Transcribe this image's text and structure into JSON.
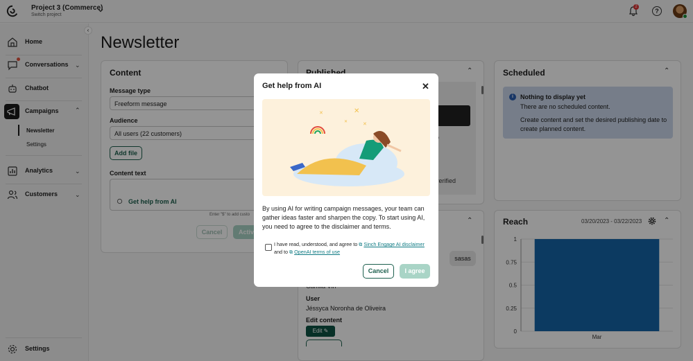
{
  "header": {
    "project_name": "Project 3 (Commerce)",
    "project_sub": "Switch project",
    "notif_count": "2",
    "help_glyph": "?"
  },
  "sidebar": {
    "items": [
      {
        "label": "Home",
        "icon": "home-icon"
      },
      {
        "label": "Conversations",
        "icon": "chat-icon"
      },
      {
        "label": "Chatbot",
        "icon": "bot-icon"
      },
      {
        "label": "Campaigns",
        "icon": "megaphone-icon"
      },
      {
        "label": "Analytics",
        "icon": "chart-icon"
      },
      {
        "label": "Customers",
        "icon": "users-icon"
      }
    ],
    "sub_items": [
      "Newsletter",
      "Settings"
    ],
    "settings_label": "Settings"
  },
  "page": {
    "title": "Newsletter"
  },
  "content_card": {
    "title": "Content",
    "message_type_label": "Message type",
    "message_type_value": "Freeform message",
    "audience_label": "Audience",
    "audience_value": "All users (22 customers)",
    "add_file": "Add file",
    "content_text_label": "Content text",
    "ai_button": "Get help from AI",
    "hint": "Enter \"$\" to add custo",
    "cancel": "Cancel",
    "activate": "Activ"
  },
  "published_card": {
    "title": "Published",
    "preview_frag_1": "o",
    "preview_frag_2": "verified",
    "msg_bubble": "sasas",
    "name_frag": "Camila Vin",
    "user_label": "User",
    "user_value": "Jéssyca Noronha de Oliveira",
    "edit_label": "Edit content",
    "edit_btn": "Edit"
  },
  "scheduled_card": {
    "title": "Scheduled",
    "info_title": "Nothing to display yet",
    "info_line1": "There are no scheduled content.",
    "info_line2": "Create content and set the desired publishing date to create planned content."
  },
  "reach_card": {
    "title": "Reach",
    "date_range": "03/20/2023 - 03/22/2023"
  },
  "chart_data": {
    "type": "bar",
    "categories": [
      "Mar"
    ],
    "values": [
      1
    ],
    "title": "",
    "xlabel": "",
    "ylabel": "",
    "ylim": [
      0,
      1
    ],
    "yticks": [
      "1",
      "0.75",
      "0.5",
      "0.25",
      "0"
    ],
    "bar_color": "#1565a8"
  },
  "modal": {
    "title": "Get help from AI",
    "close_glyph": "✕",
    "body": "By using AI for writing campaign messages, your team can gather ideas faster and sharpen the copy. To start using AI, you need to agree to the disclaimer and terms.",
    "agree_prefix": "I have read, understood, and agree to",
    "link1": "Sinch Engage AI disclaimer",
    "agree_mid": "and to",
    "link2": "OpenAI terms of use",
    "cancel": "Cancel",
    "agree": "I agree"
  }
}
